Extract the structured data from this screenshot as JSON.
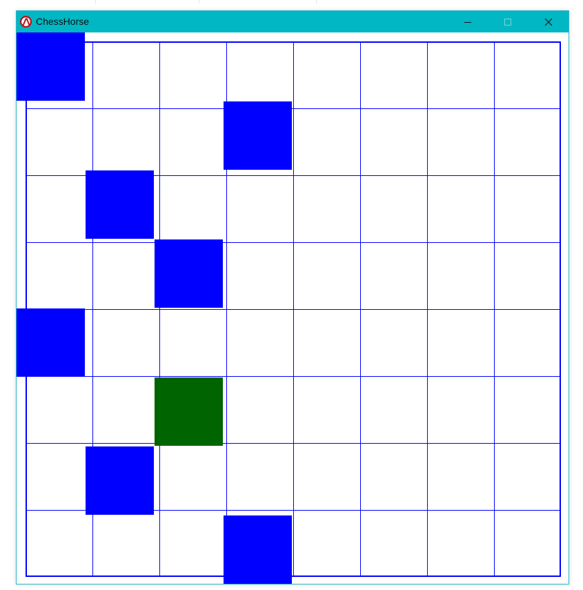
{
  "window": {
    "title": "ChessHorse",
    "icon": "racket-icon",
    "titlebar_color": "#00b7c3",
    "controls": [
      "minimize",
      "maximize",
      "close"
    ]
  },
  "board": {
    "rows": 8,
    "columns": 8,
    "line_color": "#0000ff",
    "background": "#ffffff",
    "visited_color": "#0000ff",
    "current_color": "#006400",
    "visited_cells": [
      {
        "col": 0,
        "row": 0
      },
      {
        "col": 3,
        "row": 1
      },
      {
        "col": 1,
        "row": 2
      },
      {
        "col": 2,
        "row": 3
      },
      {
        "col": 0,
        "row": 4
      },
      {
        "col": 1,
        "row": 6
      },
      {
        "col": 3,
        "row": 7
      }
    ],
    "current_cell": {
      "col": 2,
      "row": 5
    }
  }
}
